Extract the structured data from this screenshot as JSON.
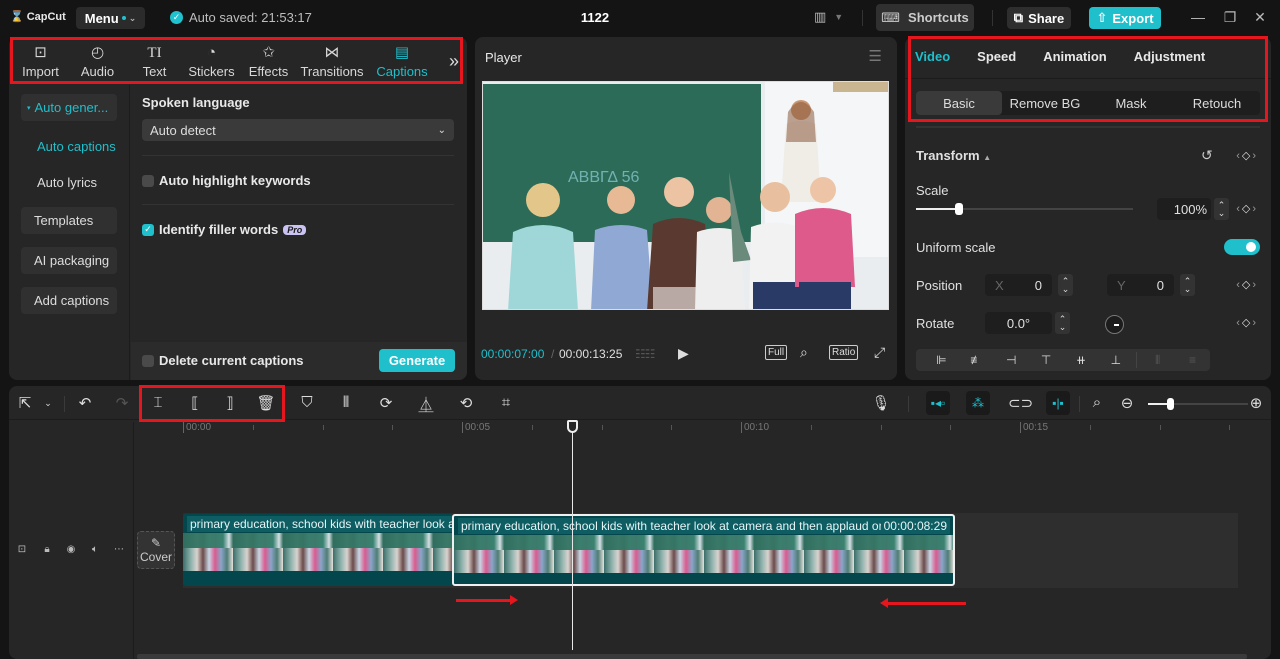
{
  "titlebar": {
    "app_name": "CapCut",
    "menu_label": "Menu",
    "autosave_text": "Auto saved: 21:53:17",
    "project_title": "1122",
    "shortcuts_label": "Shortcuts",
    "share_label": "Share",
    "export_label": "Export"
  },
  "toolbar_tabs": [
    {
      "label": "Import",
      "icon": "import-icon",
      "glyph": "▶"
    },
    {
      "label": "Audio",
      "icon": "audio-icon",
      "glyph": "♪"
    },
    {
      "label": "Text",
      "icon": "text-icon",
      "glyph": "TI"
    },
    {
      "label": "Stickers",
      "icon": "stickers-icon",
      "glyph": "◔"
    },
    {
      "label": "Effects",
      "icon": "effects-icon",
      "glyph": "✩"
    },
    {
      "label": "Transitions",
      "icon": "transitions-icon",
      "glyph": "⋈"
    },
    {
      "label": "Captions",
      "icon": "captions-icon",
      "glyph": "▭",
      "active": true
    }
  ],
  "captions_nav": {
    "auto_generate": "Auto gener...",
    "auto_captions": "Auto captions",
    "auto_lyrics": "Auto lyrics",
    "templates": "Templates",
    "ai_packaging": "AI packaging",
    "add_captions": "Add captions"
  },
  "captions_panel": {
    "spoken_language_label": "Spoken language",
    "spoken_language_value": "Auto detect",
    "auto_highlight_label": "Auto highlight keywords",
    "auto_highlight_checked": false,
    "filler_words_label": "Identify filler words",
    "filler_words_checked": true,
    "pro_badge": "Pro",
    "delete_current_label": "Delete current captions",
    "delete_current_checked": false,
    "generate_label": "Generate"
  },
  "player": {
    "title": "Player",
    "current_time": "00:00:07:00",
    "separator": "/",
    "total_time": "00:00:13:25",
    "full_label": "Full",
    "ratio_label": "Ratio"
  },
  "right_panel": {
    "tabs": [
      "Video",
      "Speed",
      "Animation",
      "Adjustment"
    ],
    "active_tab": "Video",
    "subtabs": [
      "Basic",
      "Remove BG",
      "Mask",
      "Retouch"
    ],
    "active_subtab": "Basic",
    "transform_label": "Transform",
    "scale_label": "Scale",
    "scale_value": "100%",
    "scale_slider_fraction": 0.2,
    "uniform_scale_label": "Uniform scale",
    "uniform_scale_on": true,
    "position_label": "Position",
    "position_x_label": "X",
    "position_x": "0",
    "position_y_label": "Y",
    "position_y": "0",
    "rotate_label": "Rotate",
    "rotate_value": "0.0°"
  },
  "timeline": {
    "ruler_labels": [
      "00:00",
      "00:05",
      "00:10",
      "00:15"
    ],
    "cover_label": "Cover",
    "clips": [
      {
        "label": "primary education, school kids with teacher look a",
        "duration": "",
        "selected": false
      },
      {
        "label": "primary education, school kids with teacher look at camera and then applaud on",
        "duration": "00:00:08:29",
        "selected": true
      }
    ],
    "zoom_fraction": 0.22
  },
  "colors": {
    "accent": "#1fbfcc",
    "annotation": "#e5161d",
    "clip_bg": "#03474d"
  }
}
